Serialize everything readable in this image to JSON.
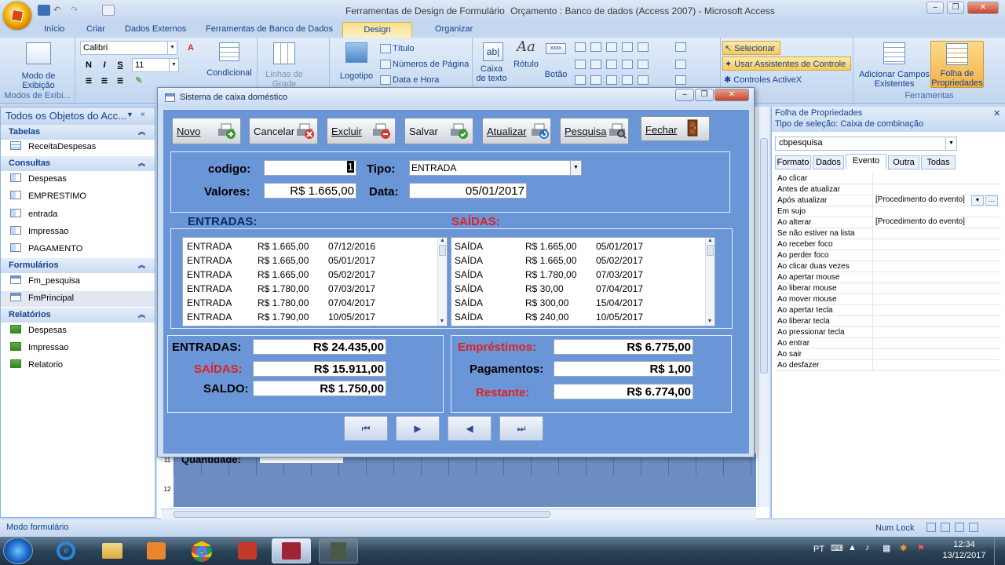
{
  "title_bar": {
    "context_tool": "Ferramentas de Design de Formulário",
    "doc_title": "Orçamento : Banco de dados (Access 2007) - Microsoft Access"
  },
  "tabs": [
    "Início",
    "Criar",
    "Dados Externos",
    "Ferramentas de Banco de Dados",
    "Design",
    "Organizar"
  ],
  "ribbon": {
    "views_label": "Modo de Exibição",
    "views_group": "Modos de Exibi...",
    "font_name": "Calibri",
    "font_size": "11",
    "bold": "N",
    "italic": "I",
    "underline": "S",
    "conditional": "Condicional",
    "gridlines": "Linhas de Grade",
    "logo": "Logotipo",
    "titulo": "Título",
    "page_numbers": "Números de Página",
    "date_time": "Data e Hora",
    "textbox": "Caixa de texto",
    "label": "Rótulo",
    "button": "Botão",
    "select": "Selecionar",
    "use_wizards": "Usar Assistentes de Controle",
    "activex": "Controles ActiveX",
    "add_fields": "Adicionar Campos Existentes",
    "prop_sheet": "Folha de Propriedades",
    "tools_group": "Ferramentas"
  },
  "nav": {
    "header": "Todos os Objetos do Acc...",
    "sections": [
      {
        "title": "Tabelas",
        "items": [
          "ReceitaDespesas"
        ]
      },
      {
        "title": "Consultas",
        "items": [
          "Despesas",
          "EMPRESTIMO",
          "entrada",
          "Impressao",
          "PAGAMENTO"
        ]
      },
      {
        "title": "Formulários",
        "items": [
          "Fm_pesquisa",
          "FmPrincipal"
        ]
      },
      {
        "title": "Relatórios",
        "items": [
          "Despesas",
          "Impressao",
          "Relatorio"
        ]
      }
    ]
  },
  "design_bg": {
    "quantidade_label": "Quantidade:",
    "ruler_11": "11",
    "ruler_12": "12"
  },
  "window": {
    "title": "Sistema de caixa doméstico",
    "buttons": [
      "Novo",
      "Cancelar",
      "Excluir",
      "Salvar",
      "Atualizar",
      "Pesquisa",
      "Fechar"
    ],
    "codigo_label": "codigo:",
    "codigo_value": "1",
    "tipo_label": "Tipo:",
    "tipo_value": "ENTRADA",
    "valores_label": "Valores:",
    "valores_value": "R$ 1.665,00",
    "data_label": "Data:",
    "data_value": "05/01/2017",
    "entradas_header": "ENTRADAS:",
    "saidas_header": "SAÍDAS:",
    "entradas_list": [
      [
        "ENTRADA",
        "R$ 1.665,00",
        "07/12/2016"
      ],
      [
        "ENTRADA",
        "R$ 1.665,00",
        "05/01/2017"
      ],
      [
        "ENTRADA",
        "R$ 1.665,00",
        "05/02/2017"
      ],
      [
        "ENTRADA",
        "R$ 1.780,00",
        "07/03/2017"
      ],
      [
        "ENTRADA",
        "R$ 1.780,00",
        "07/04/2017"
      ],
      [
        "ENTRADA",
        "R$ 1.790,00",
        "10/05/2017"
      ]
    ],
    "saidas_list": [
      [
        "SAÍDA",
        "R$ 1.665,00",
        "05/01/2017"
      ],
      [
        "SAÍDA",
        "R$ 1.665,00",
        "05/02/2017"
      ],
      [
        "SAÍDA",
        "R$ 1.780,00",
        "07/03/2017"
      ],
      [
        "SAÍDA",
        "R$ 30,00",
        "07/04/2017"
      ],
      [
        "SAÍDA",
        "R$ 300,00",
        "15/04/2017"
      ],
      [
        "SAÍDA",
        "R$ 240,00",
        "10/05/2017"
      ]
    ],
    "totals": {
      "entradas_label": "ENTRADAS:",
      "entradas_value": "R$ 24.435,00",
      "saidas_label": "SAÍDAS:",
      "saidas_value": "R$ 15.911,00",
      "saldo_label": "SALDO:",
      "saldo_value": "R$ 1.750,00",
      "emprestimos_label": "Empréstimos:",
      "emprestimos_value": "R$ 6.775,00",
      "pagamentos_label": "Pagamentos:",
      "pagamentos_value": "R$ 1,00",
      "restante_label": "Restante:",
      "restante_value": "R$ 6.774,00"
    }
  },
  "props": {
    "title": "Folha de Propriedades",
    "selection_type": "Tipo de seleção:  Caixa de combinação",
    "selected": "cbpesquisa",
    "tabs": [
      "Formato",
      "Dados",
      "Evento",
      "Outra",
      "Todas"
    ],
    "rows": [
      [
        "Ao clicar",
        ""
      ],
      [
        "Antes de atualizar",
        ""
      ],
      [
        "Após atualizar",
        "[Procedimento do evento]"
      ],
      [
        "Em sujo",
        ""
      ],
      [
        "Ao alterar",
        "[Procedimento do evento]"
      ],
      [
        "Se não estiver na lista",
        ""
      ],
      [
        "Ao receber foco",
        ""
      ],
      [
        "Ao perder foco",
        ""
      ],
      [
        "Ao clicar duas vezes",
        ""
      ],
      [
        "Ao apertar mouse",
        ""
      ],
      [
        "Ao liberar mouse",
        ""
      ],
      [
        "Ao mover mouse",
        ""
      ],
      [
        "Ao apertar tecla",
        ""
      ],
      [
        "Ao liberar tecla",
        ""
      ],
      [
        "Ao pressionar tecla",
        ""
      ],
      [
        "Ao entrar",
        ""
      ],
      [
        "Ao sair",
        ""
      ],
      [
        "Ao desfazer",
        ""
      ]
    ]
  },
  "status": {
    "left": "Modo formulário",
    "numlock": "Num Lock"
  },
  "taskbar": {
    "lang": "PT",
    "time": "12:34",
    "date": "13/12/2017"
  },
  "colors": {
    "form_bg": "#6a96d8",
    "accent_red": "#e02020",
    "ribbon_blue": "#15428b"
  }
}
